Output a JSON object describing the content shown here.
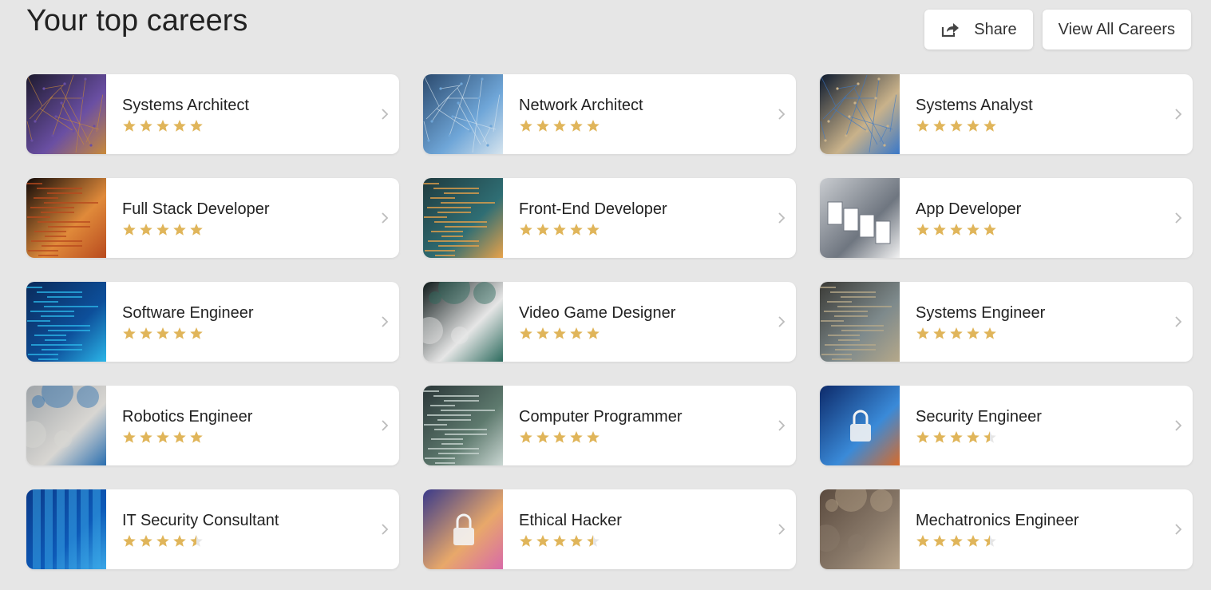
{
  "header": {
    "title": "Your top careers",
    "share_label": "Share",
    "view_all_label": "View All Careers"
  },
  "colors": {
    "star": "#e0b55a",
    "star_empty": "#e6e6e6",
    "chevron": "#bcbcbc"
  },
  "careers": [
    {
      "title": "Systems Architect",
      "rating": 5,
      "image": "network-mesh",
      "colors": [
        "#1d1a2e",
        "#c98a3a",
        "#6a4fa3"
      ]
    },
    {
      "title": "Network Architect",
      "rating": 5,
      "image": "hands-typing-network",
      "colors": [
        "#2b4a6e",
        "#d6e4ee",
        "#6fa6d8"
      ]
    },
    {
      "title": "Systems Analyst",
      "rating": 5,
      "image": "tablet-hologram",
      "colors": [
        "#0d1a2e",
        "#3a78c8",
        "#c9b28a"
      ]
    },
    {
      "title": "Full Stack Developer",
      "rating": 5,
      "image": "code-rain",
      "colors": [
        "#120a08",
        "#b84a1e",
        "#e08a3a"
      ]
    },
    {
      "title": "Front-End Developer",
      "rating": 5,
      "image": "code-screen-sunset",
      "colors": [
        "#1f3a3e",
        "#e8a24a",
        "#2f6e74"
      ]
    },
    {
      "title": "App Developer",
      "rating": 5,
      "image": "wireframe-sketches",
      "colors": [
        "#c9ccd0",
        "#f2f2f2",
        "#6f7680"
      ]
    },
    {
      "title": "Software Engineer",
      "rating": 5,
      "image": "digital-code-blue",
      "colors": [
        "#0a2a5a",
        "#2bb6e8",
        "#0d4f9a"
      ]
    },
    {
      "title": "Video Game Designer",
      "rating": 5,
      "image": "gaming-explosion",
      "colors": [
        "#0f1a1a",
        "#2d6b5e",
        "#e6e6e6"
      ]
    },
    {
      "title": "Systems Engineer",
      "rating": 5,
      "image": "laptop-code-office",
      "colors": [
        "#3a3a36",
        "#b5a88a",
        "#7e8a8c"
      ]
    },
    {
      "title": "Robotics Engineer",
      "rating": 5,
      "image": "robot-tablet",
      "colors": [
        "#9fa4a8",
        "#2b6fb0",
        "#d8d6d2"
      ]
    },
    {
      "title": "Computer Programmer",
      "rating": 5,
      "image": "laptop-code",
      "colors": [
        "#2a3638",
        "#c9d6d2",
        "#5e7a6e"
      ]
    },
    {
      "title": "Security Engineer",
      "rating": 4.5,
      "image": "padlock-keyboard",
      "colors": [
        "#0d2a6a",
        "#d86b2a",
        "#3a8ad8"
      ]
    },
    {
      "title": "IT Security Consultant",
      "rating": 4.5,
      "image": "server-racks",
      "colors": [
        "#0a3a8a",
        "#3aa8e8",
        "#0d5ab8"
      ]
    },
    {
      "title": "Ethical Hacker",
      "rating": 4.5,
      "image": "padlock-bokeh",
      "colors": [
        "#3a3a8a",
        "#d86aa8",
        "#e8a86a"
      ]
    },
    {
      "title": "Mechatronics Engineer",
      "rating": 4.5,
      "image": "robotic-hand",
      "colors": [
        "#5a4a3e",
        "#b8a48a",
        "#8a7a6a"
      ]
    }
  ]
}
